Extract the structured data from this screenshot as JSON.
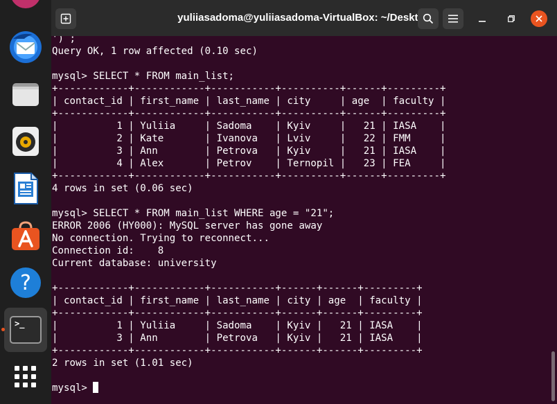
{
  "window": {
    "title": "yuliiasadoma@yuliiasadoma-VirtualBox: ~/Desktop"
  },
  "dock": {
    "items": [
      "thunderbird-icon",
      "files-icon",
      "rhythmbox-icon",
      "libreoffice-writer-icon",
      "software-center-icon",
      "help-icon",
      "terminal-icon",
      "show-apps-icon"
    ],
    "terminal_glyph": ">_"
  },
  "terminal": {
    "lines": [
      "') ;",
      "Query OK, 1 row affected (0.10 sec)",
      "",
      "mysql> SELECT * FROM main_list;",
      "+------------+------------+-----------+----------+------+---------+",
      "| contact_id | first_name | last_name | city     | age  | faculty |",
      "+------------+------------+-----------+----------+------+---------+",
      "|          1 | Yuliia     | Sadoma    | Kyiv     |   21 | IASA    |",
      "|          2 | Kate       | Ivanova   | Lviv     |   22 | FMM     |",
      "|          3 | Ann        | Petrova   | Kyiv     |   21 | IASA    |",
      "|          4 | Alex       | Petrov    | Ternopil |   23 | FEA     |",
      "+------------+------------+-----------+----------+------+---------+",
      "4 rows in set (0.06 sec)",
      "",
      "mysql> SELECT * FROM main_list WHERE age = \"21\";",
      "ERROR 2006 (HY000): MySQL server has gone away",
      "No connection. Trying to reconnect...",
      "Connection id:    8",
      "Current database: university",
      "",
      "+------------+------------+-----------+------+------+---------+",
      "| contact_id | first_name | last_name | city | age  | faculty |",
      "+------------+------------+-----------+------+------+---------+",
      "|          1 | Yuliia     | Sadoma    | Kyiv |   21 | IASA    |",
      "|          3 | Ann        | Petrova   | Kyiv |   21 | IASA    |",
      "+------------+------------+-----------+------+------+---------+",
      "2 rows in set (1.01 sec)",
      "",
      "mysql> "
    ]
  },
  "colors": {
    "terminal_bg": "#300a24",
    "accent": "#e95420",
    "titlebar": "#2b2b2b",
    "dock": "#1f1f1f"
  }
}
